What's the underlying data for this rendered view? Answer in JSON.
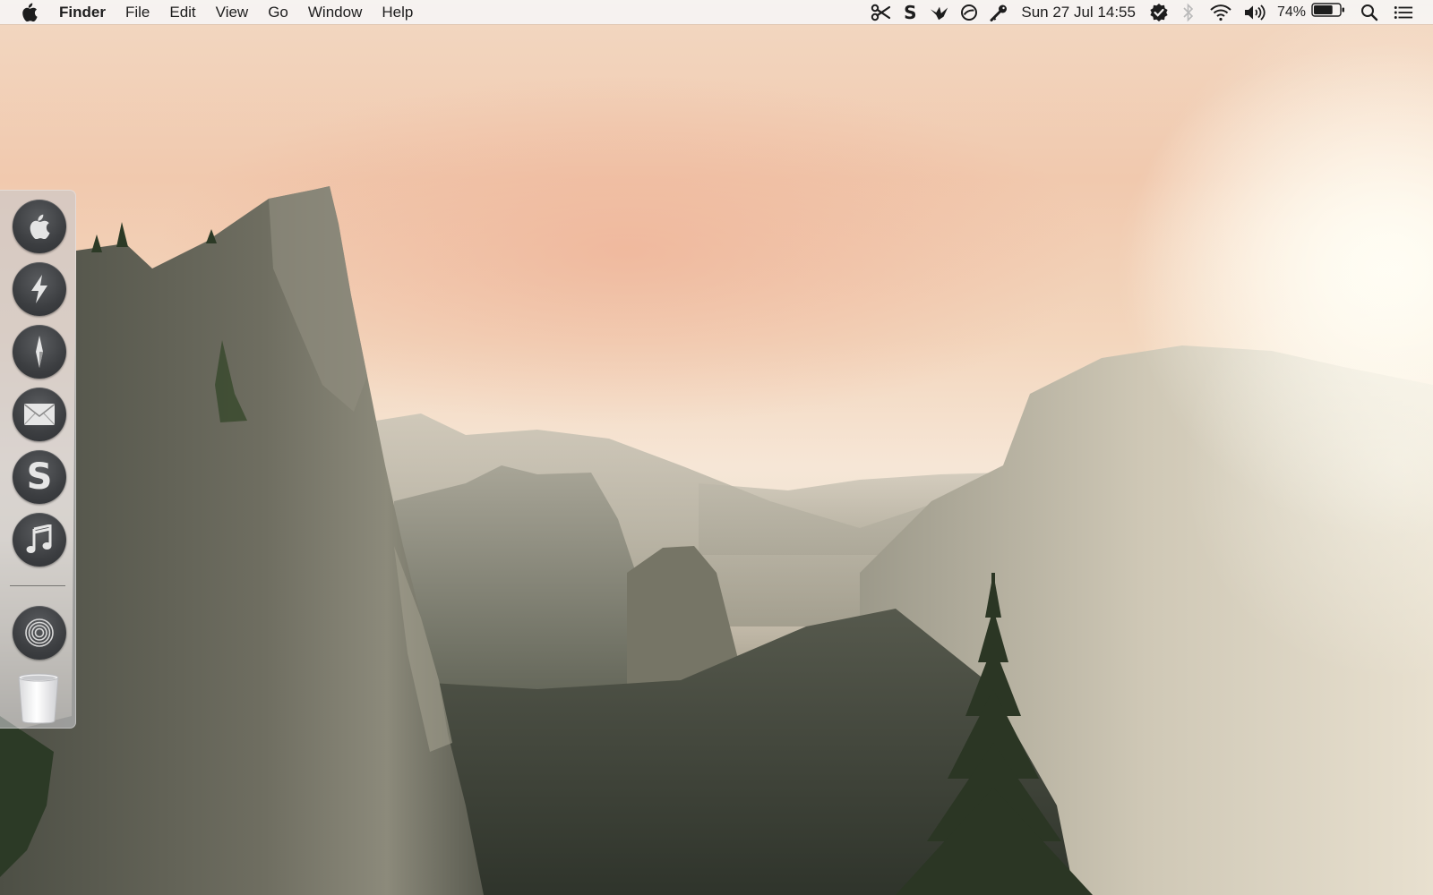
{
  "menubar": {
    "app_name": "Finder",
    "menus": [
      "File",
      "Edit",
      "View",
      "Go",
      "Window",
      "Help"
    ],
    "status_icons": [
      "scissors-icon",
      "s-glyph-icon",
      "crane-icon",
      "do-not-disturb-icon",
      "key-icon",
      "checkmark-badge-icon",
      "bluetooth-icon",
      "wifi-icon",
      "volume-icon",
      "battery-icon",
      "spotlight-icon",
      "notification-center-icon"
    ],
    "s_glyph": "S",
    "clock": "Sun 27 Jul  14:55",
    "battery_percent": "74%",
    "battery_level": 0.74
  },
  "dock": {
    "apps": [
      {
        "name": "apple-icon"
      },
      {
        "name": "bolt-icon"
      },
      {
        "name": "compass-icon"
      },
      {
        "name": "mail-icon"
      },
      {
        "name": "s-app-icon",
        "glyph": "S"
      },
      {
        "name": "music-note-icon"
      }
    ],
    "others": [
      {
        "name": "circles-icon"
      },
      {
        "name": "trash-icon"
      }
    ]
  }
}
